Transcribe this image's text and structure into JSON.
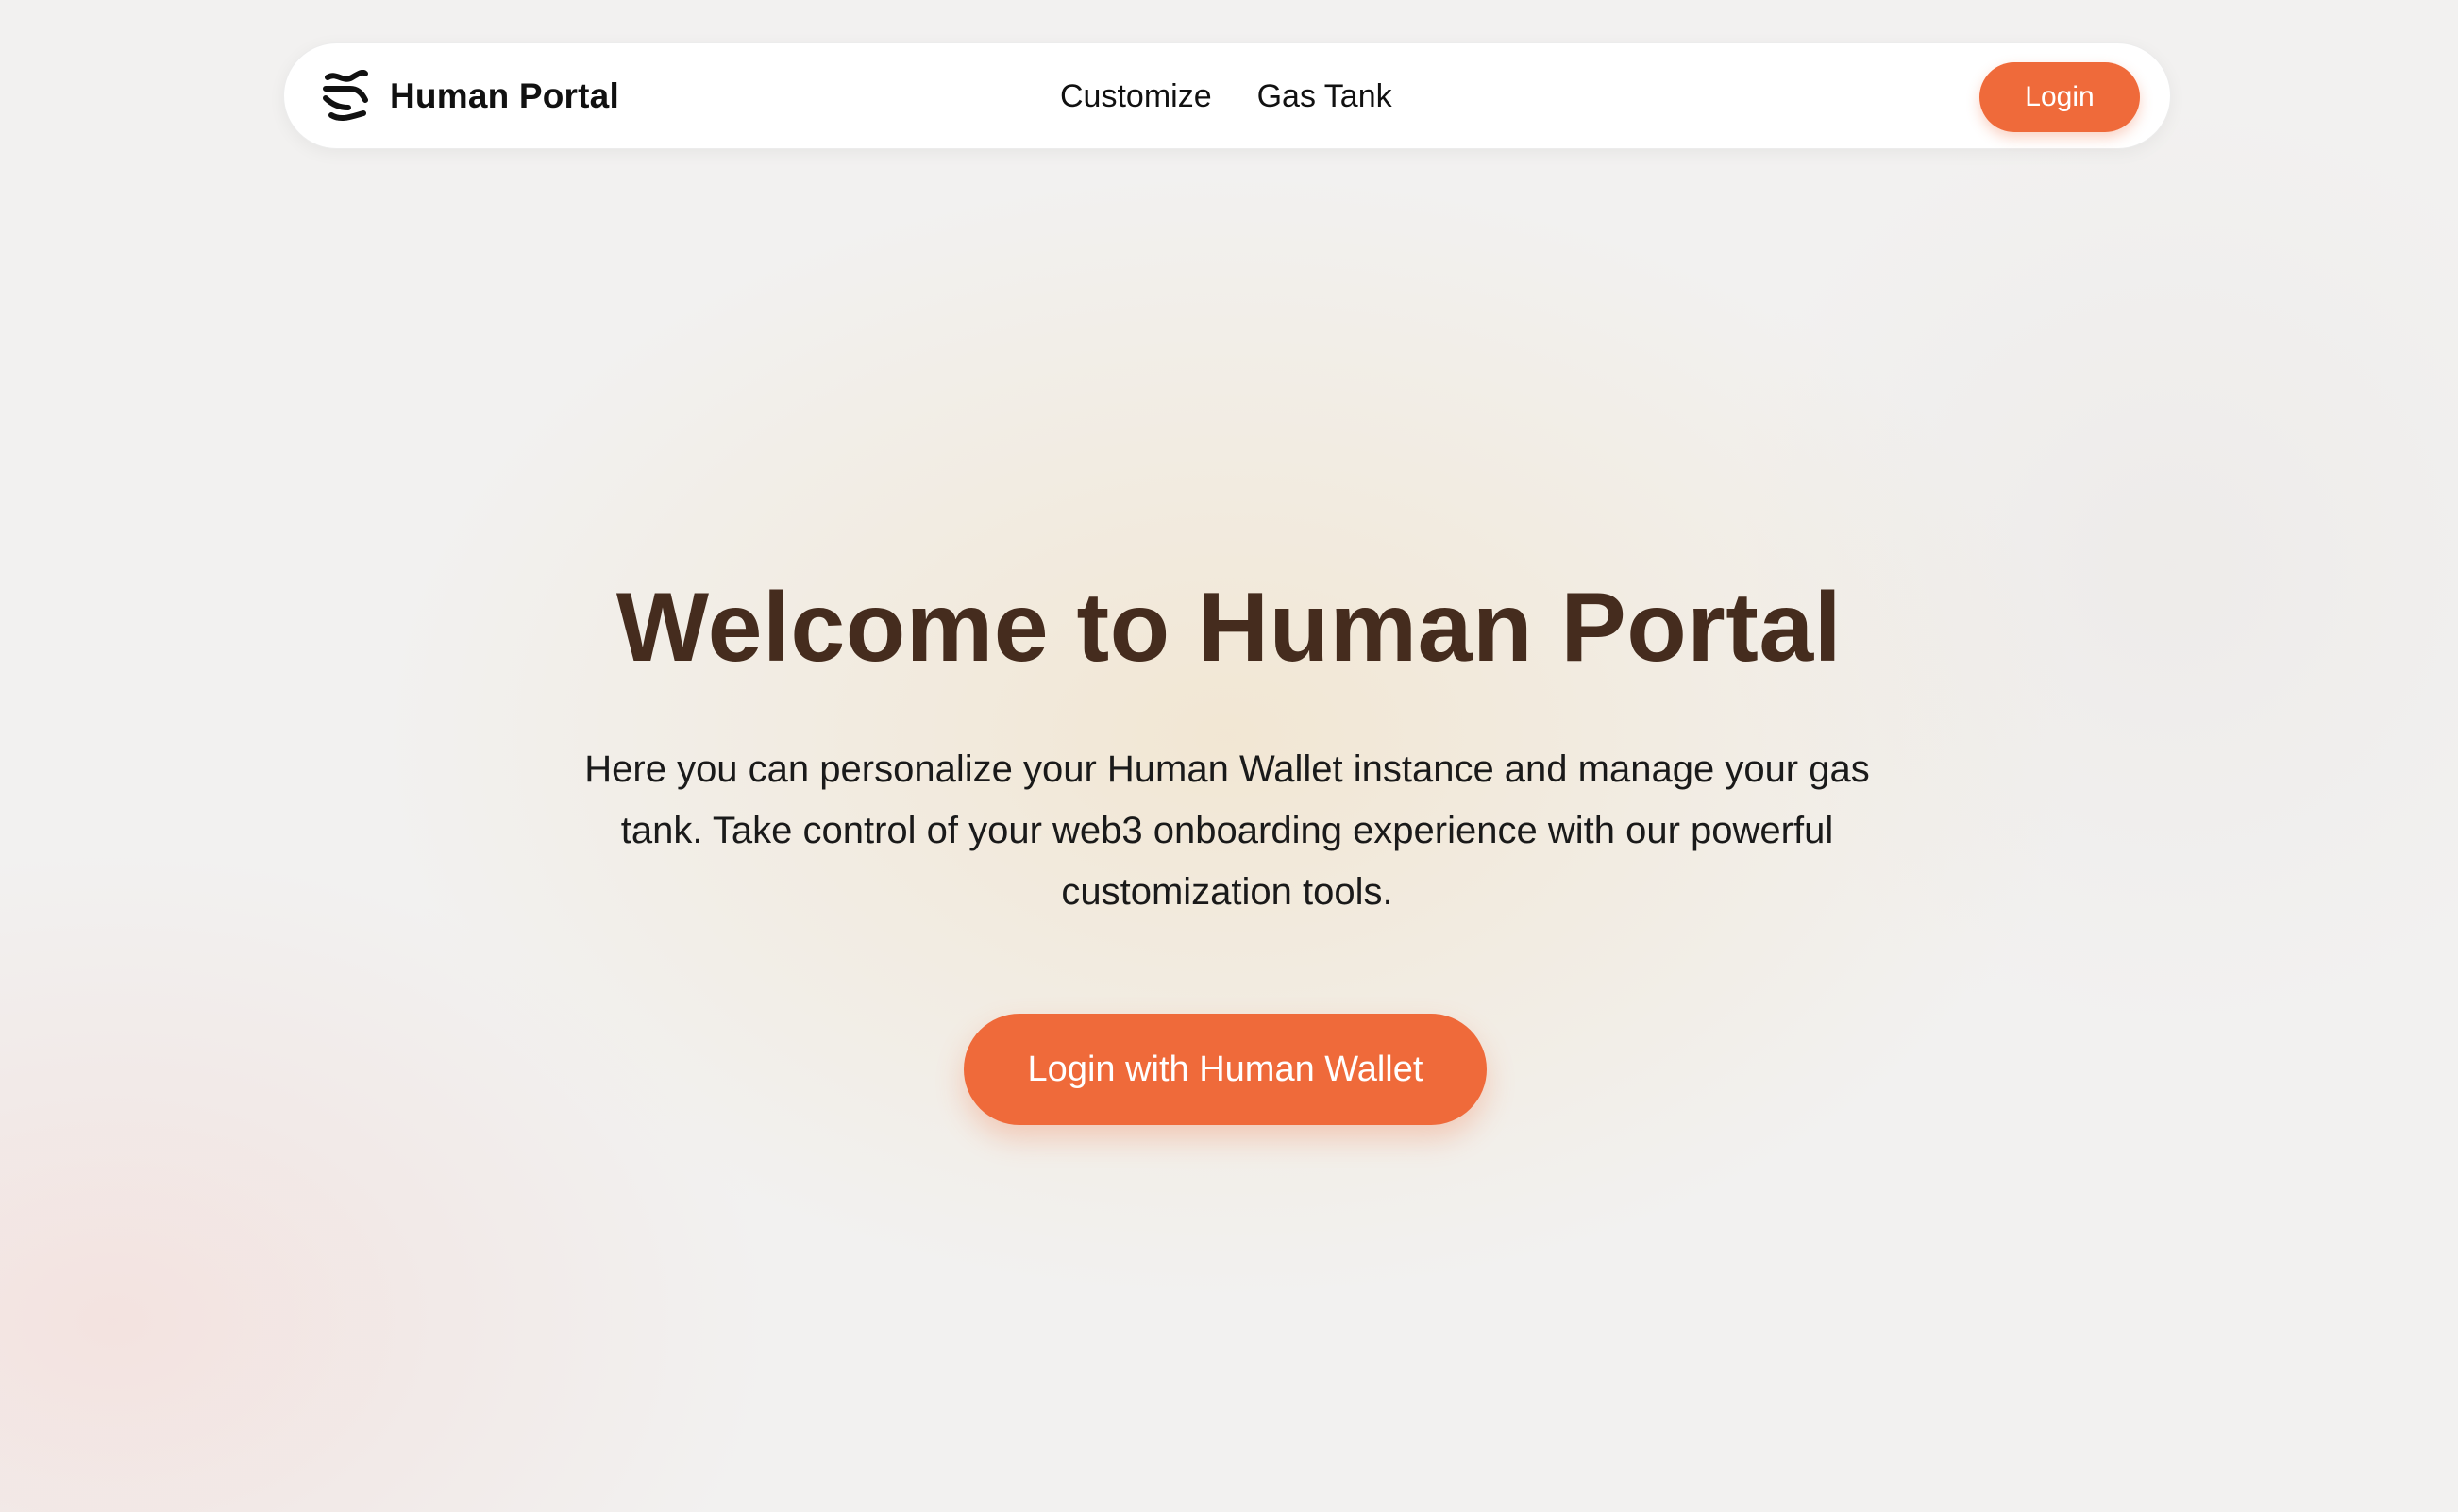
{
  "header": {
    "brand_name": "Human Portal",
    "brand_icon": "wave-logo-icon",
    "nav": [
      {
        "label": "Customize"
      },
      {
        "label": "Gas Tank"
      }
    ],
    "login_label": "Login"
  },
  "hero": {
    "title": "Welcome to Human Portal",
    "description": "Here you can personalize your Human Wallet instance and manage your gas tank. Take control of your web3 onboarding experience with our powerful customization tools.",
    "cta_label": "Login with Human Wallet"
  },
  "colors": {
    "accent": "#ef6a3a",
    "title": "#452c1e",
    "background": "#f2f1f0"
  }
}
